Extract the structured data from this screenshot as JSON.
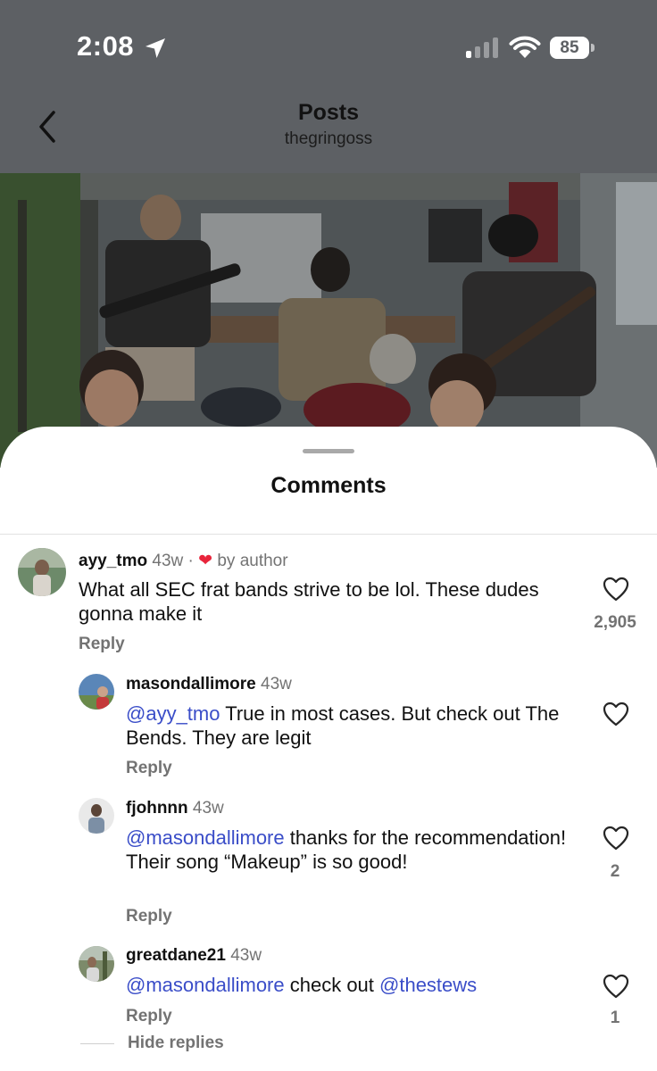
{
  "status_bar": {
    "time": "2:08",
    "battery": "85"
  },
  "nav": {
    "title": "Posts",
    "subtitle": "thegringoss"
  },
  "sheet": {
    "title": "Comments"
  },
  "comments": [
    {
      "username": "ayy_tmo",
      "age": "43w",
      "separator": " · ",
      "liked_by_author": "by author",
      "text": "What all SEC frat bands strive to be lol. These dudes gonna make it",
      "reply": "Reply",
      "likes": "2,905"
    },
    {
      "username": "masondallimore",
      "age": "43w",
      "mention": "@ayy_tmo",
      "text": " True in most cases. But check out The Bends. They are legit",
      "reply": "Reply",
      "likes": ""
    },
    {
      "username": "fjohnnn",
      "age": "43w",
      "mention": "@masondallimore",
      "text": " thanks for the recommendation! Their song “Makeup” is so good!",
      "reply": "Reply",
      "likes": "2"
    },
    {
      "username": "greatdane21",
      "age": "43w",
      "mention": "@masondallimore",
      "text_mid": " check out ",
      "mention2": "@thestews",
      "reply": "Reply",
      "likes": "1"
    }
  ],
  "hide_replies": "Hide replies",
  "icons": {
    "back": "chevron-left-icon",
    "location": "location-arrow-icon",
    "signal": "cellular-signal-icon",
    "wifi": "wifi-icon",
    "like": "heart-outline-icon",
    "author_like": "heart-filled-icon"
  },
  "colors": {
    "mention": "#3a4dc8",
    "author_heart": "#e8243b",
    "header_bg": "#5d6064"
  }
}
